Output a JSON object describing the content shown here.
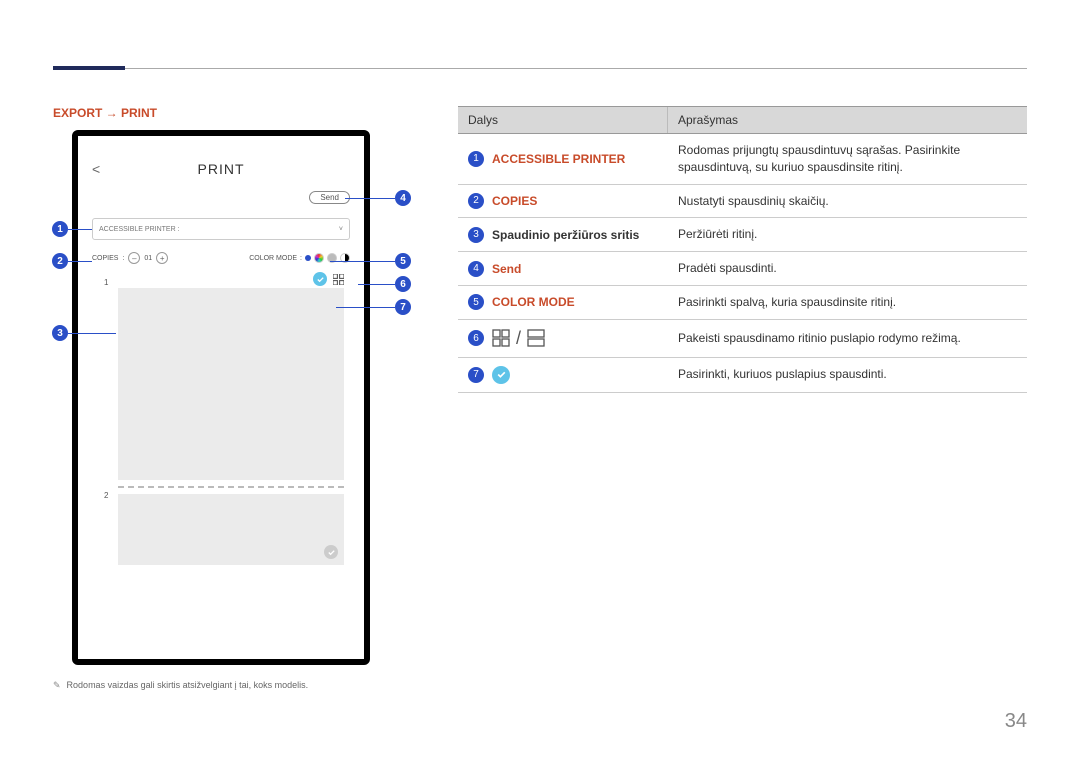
{
  "breadcrumb": "EXPORT → PRINT",
  "device": {
    "title": "PRINT",
    "send_label": "Send",
    "printer_label": "ACCESSIBLE PRINTER :",
    "copies_label": "COPIES",
    "copies_value": "01",
    "colormode_label": "COLOR MODE",
    "page1_num": "1",
    "page2_num": "2"
  },
  "callouts": [
    "1",
    "2",
    "3",
    "4",
    "5",
    "6",
    "7"
  ],
  "table": {
    "head1": "Dalys",
    "head2": "Aprašymas",
    "rows": [
      {
        "num": "1",
        "label": "ACCESSIBLE PRINTER",
        "red": true,
        "desc": "Rodomas prijungtų spausdintuvų sąrašas. Pasirinkite spausdintuvą, su kuriuo spausdinsite ritinį."
      },
      {
        "num": "2",
        "label": "COPIES",
        "red": true,
        "desc": "Nustatyti spausdinių skaičių."
      },
      {
        "num": "3",
        "label": "Spaudinio peržiūros sritis",
        "red": false,
        "desc": "Peržiūrėti ritinį."
      },
      {
        "num": "4",
        "label": "Send",
        "red": true,
        "desc": "Pradėti spausdinti."
      },
      {
        "num": "5",
        "label": "COLOR MODE",
        "red": true,
        "desc": "Pasirinkti spalvą, kuria spausdinsite ritinį."
      },
      {
        "num": "6",
        "label": "_layout_icons_",
        "red": false,
        "desc": "Pakeisti spausdinamo ritinio puslapio rodymo režimą."
      },
      {
        "num": "7",
        "label": "_check_icon_",
        "red": false,
        "desc": "Pasirinkti, kuriuos puslapius spausdinti."
      }
    ]
  },
  "footnote": "Rodomas vaizdas gali skirtis atsižvelgiant į tai, koks modelis.",
  "page_number": "34"
}
